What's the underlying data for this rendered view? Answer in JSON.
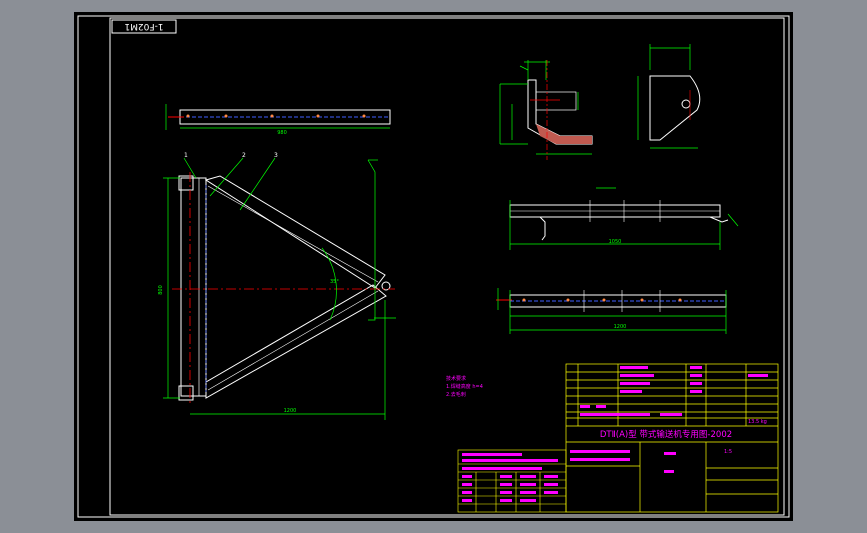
{
  "drawing": {
    "corner_label": "1-F02M1",
    "title_main": "DTⅡ(A)型 带式输送机专用图-2002",
    "scale": "1:5",
    "mass": "13.5 kg",
    "dim_span": "1200",
    "dim_height": "800",
    "angle": "35°",
    "label_1": "1",
    "label_2": "2",
    "label_3": "3",
    "dim_top_plate": "980",
    "dim_bottom_strip": "1200",
    "dim_mid_strip": "1050"
  },
  "notes": {
    "lines": [
      "技术要求",
      "1.焊缝高度 h=4",
      "2.去毛刺"
    ]
  },
  "colors": {
    "background": "#000000",
    "outer": "#8b8f96",
    "part": "#ffffff",
    "dimension": "#00ff00",
    "centerline": "#ff0000",
    "hidden": "#4060ff",
    "text": "#ff00ff",
    "table": "#ffff00"
  }
}
